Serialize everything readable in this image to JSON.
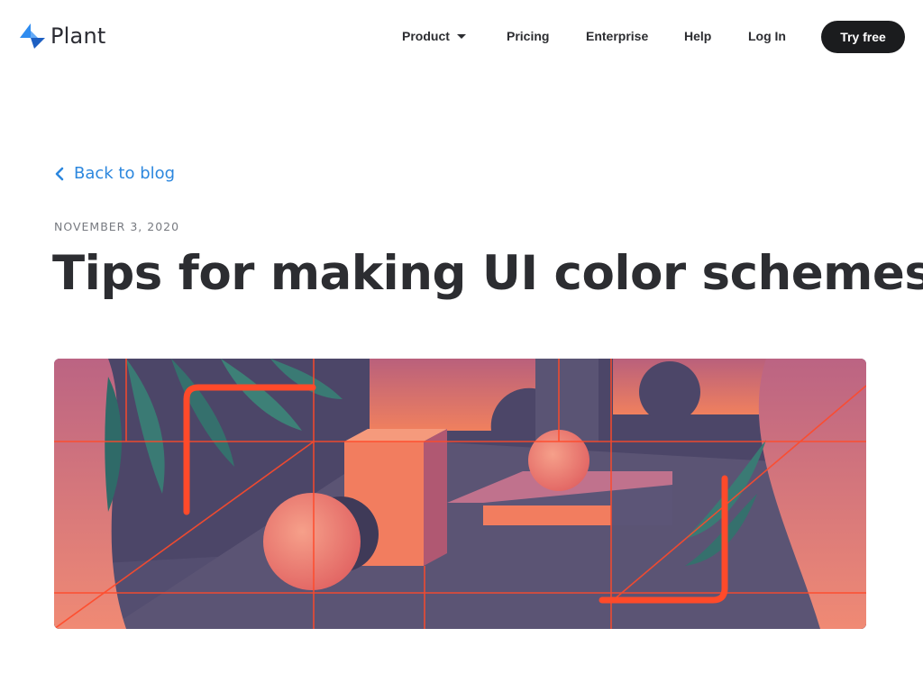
{
  "header": {
    "brand_name": "Plant",
    "logo_icon": "plant-logo-icon",
    "nav": {
      "product": "Product",
      "pricing": "Pricing",
      "enterprise": "Enterprise",
      "help": "Help",
      "login": "Log In"
    },
    "cta_label": "Try free"
  },
  "article": {
    "back_label": "Back to blog",
    "date": "NOVEMBER 3, 2020",
    "title": "Tips for making UI color schemes",
    "hero_image": "abstract-geometric-room-illustration"
  },
  "colors": {
    "link_blue": "#2c87de",
    "logo_blue": "#2f8cf0",
    "cta_background": "#1b1c1e",
    "accent_orange": "#ff4a2a",
    "illustration_purple": "#4c4668"
  }
}
